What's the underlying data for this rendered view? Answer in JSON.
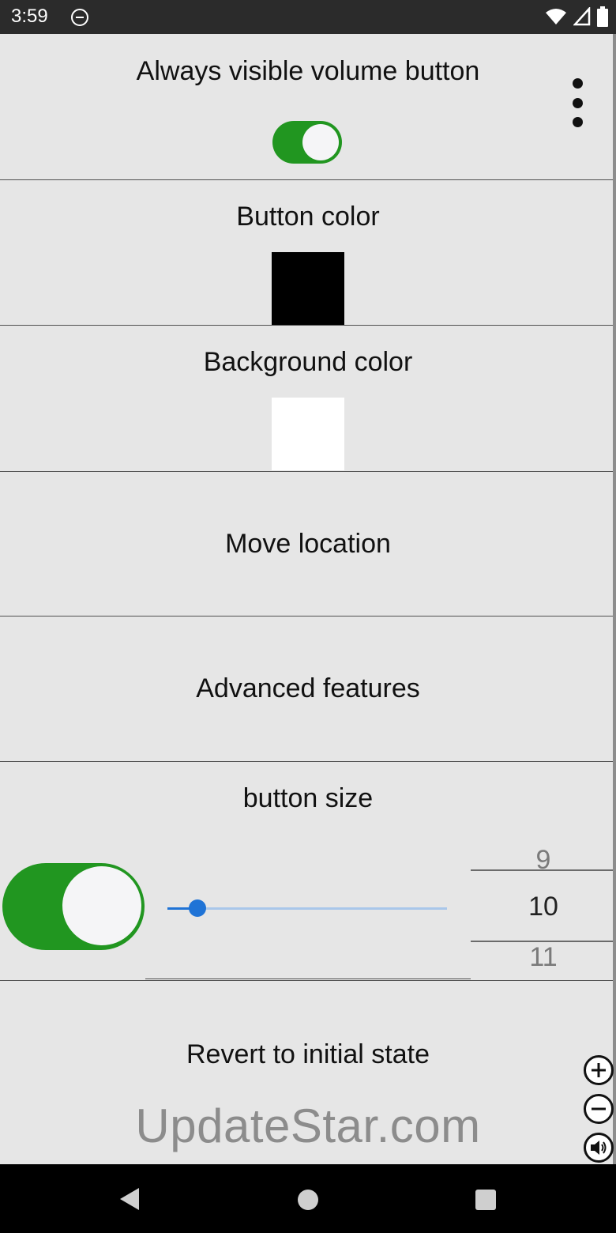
{
  "status_bar": {
    "time": "3:59",
    "icons": [
      "dnd-icon",
      "wifi-icon",
      "signal-icon",
      "battery-icon"
    ]
  },
  "settings": {
    "always_visible": {
      "title": "Always visible volume button",
      "enabled": true
    },
    "button_color": {
      "title": "Button color",
      "color": "#000000"
    },
    "background_color": {
      "title": "Background color",
      "color": "#ffffff"
    },
    "move_location": {
      "title": "Move location"
    },
    "advanced_features": {
      "title": "Advanced features"
    },
    "button_size": {
      "title": "button size",
      "enabled": true,
      "slider_fraction": 0.08,
      "picker": {
        "prev": "9",
        "current": "10",
        "next": "11"
      }
    },
    "revert": {
      "title": "Revert to initial state"
    }
  },
  "overlay_controls": [
    "plus-circle-icon",
    "minus-circle-icon",
    "volume-icon"
  ],
  "watermark": "UpdateStar.com",
  "colors": {
    "accent_green": "#219620",
    "slider_blue": "#1f73d6",
    "background": "#e6e6e6"
  }
}
